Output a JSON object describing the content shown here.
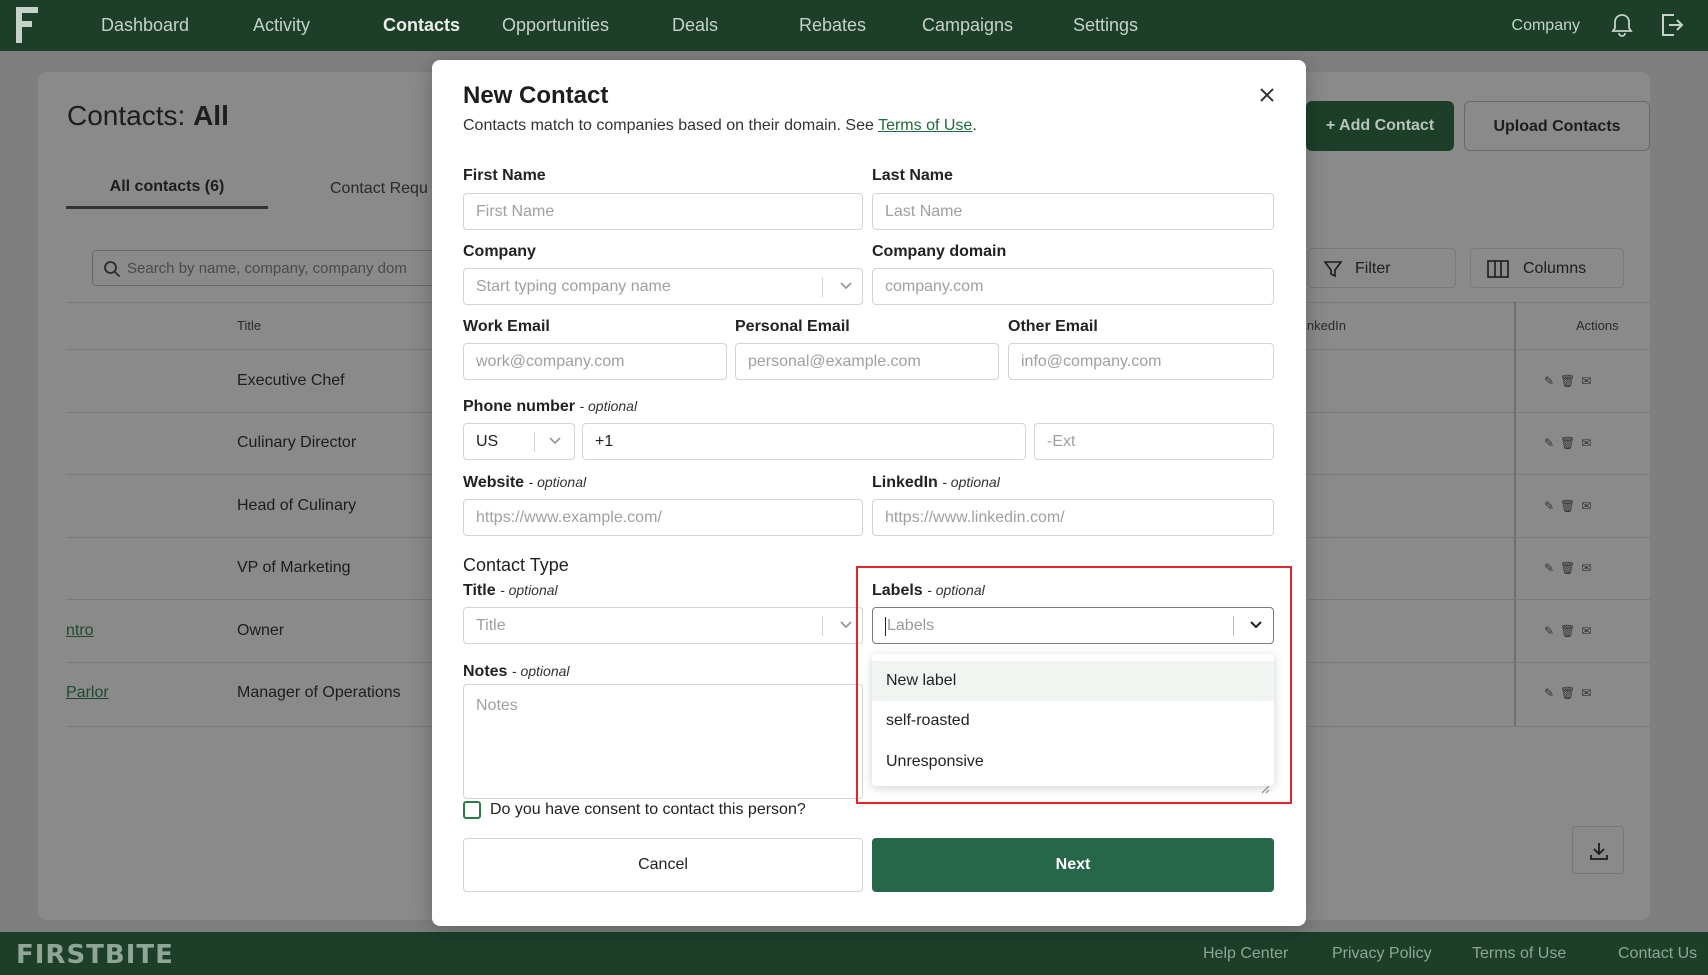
{
  "nav": {
    "items": [
      "Dashboard",
      "Activity",
      "Contacts",
      "Opportunities",
      "Deals",
      "Rebates",
      "Campaigns",
      "Settings"
    ],
    "active": "Contacts",
    "company": "Company"
  },
  "page": {
    "title_prefix": "Contacts: ",
    "title_bold": "All",
    "tab_all": "All contacts (6)",
    "tab_requests": "Contact Requ",
    "search_placeholder": "Search by name, company, company dom",
    "add_contact": "+ Add Contact",
    "upload_contacts": "Upload Contacts",
    "filter": "Filter",
    "columns": "Columns",
    "th_title": "Title",
    "th_linkedin": "inkedIn",
    "th_actions": "Actions",
    "rows": [
      {
        "title": "Executive Chef",
        "link": ""
      },
      {
        "title": "Culinary Director",
        "link": ""
      },
      {
        "title": "Head of Culinary",
        "link": ""
      },
      {
        "title": "VP of Marketing",
        "link": ""
      },
      {
        "title": "Owner",
        "link": "ntro"
      },
      {
        "title": "Manager of Operations",
        "link": "Parlor"
      }
    ],
    "actions_glyphs": "✎🗑✉"
  },
  "modal": {
    "title": "New Contact",
    "subtitle": "Contacts match to companies based on their domain. See ",
    "terms_link": "Terms of Use",
    "subtitle_end": ".",
    "first_name_label": "First Name",
    "first_name_ph": "First Name",
    "last_name_label": "Last Name",
    "last_name_ph": "Last Name",
    "company_label": "Company",
    "company_ph": "Start typing company name",
    "company_domain_label": "Company domain",
    "company_domain_ph": "company.com",
    "work_email_label": "Work Email",
    "work_email_ph": "work@company.com",
    "personal_email_label": "Personal Email",
    "personal_email_ph": "personal@example.com",
    "other_email_label": "Other Email",
    "other_email_ph": "info@company.com",
    "phone_label": "Phone number",
    "optional": "- optional",
    "country": "US",
    "phone_value": "+1",
    "ext_ph": "-Ext",
    "website_label": "Website",
    "website_ph": "https://www.example.com/",
    "linkedin_label": "LinkedIn",
    "linkedin_ph": "https://www.linkedin.com/",
    "contact_type": "Contact Type",
    "title_label": "Title",
    "title_ph": "Title",
    "labels_label": "Labels",
    "labels_ph": "Labels",
    "notes_label": "Notes",
    "notes_ph": "Notes",
    "consent": "Do you have consent to contact this person?",
    "cancel": "Cancel",
    "next": "Next"
  },
  "dropdown": {
    "options": [
      "New label",
      "self-roasted",
      "Unresponsive"
    ]
  },
  "footer": {
    "logo": "FIRSTBITE",
    "links": [
      "Help Center",
      "Privacy Policy",
      "Terms of Use",
      "Contact Us"
    ]
  },
  "colors": {
    "brand": "#1d3f2a",
    "primary_button": "#26674a",
    "highlight": "#e0252b"
  }
}
